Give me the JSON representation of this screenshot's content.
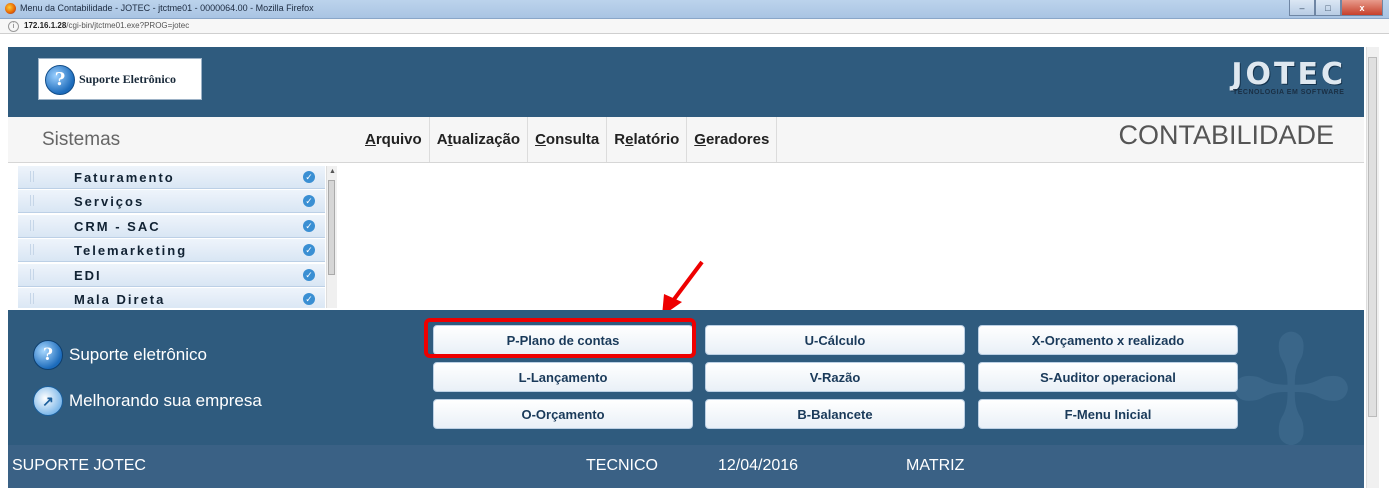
{
  "window": {
    "title": "Menu da Contabilidade - JOTEC - jtctme01 - 0000064.00 - Mozilla Firefox",
    "url_host": "172.16.1.28",
    "url_path": "/cgi-bin/jtctme01.exe?PROG=jotec",
    "min_glyph": "–",
    "max_glyph": "□",
    "close_glyph": "x"
  },
  "header": {
    "support_logo_text": "Suporte Eletrônico",
    "jotec_logo": "JOTEC",
    "jotec_tagline": "TECNOLOGIA EM SOFTWARE"
  },
  "menubar": {
    "sistemas": "Sistemas",
    "menus": [
      {
        "prefix": "",
        "underline": "A",
        "rest": "rquivo"
      },
      {
        "prefix": "A",
        "underline": "t",
        "rest": "ualização"
      },
      {
        "prefix": "",
        "underline": "C",
        "rest": "onsulta"
      },
      {
        "prefix": "R",
        "underline": "e",
        "rest": "latório"
      },
      {
        "prefix": "",
        "underline": "G",
        "rest": "eradores"
      }
    ],
    "module_title": "CONTABILIDADE"
  },
  "sidebar": {
    "items": [
      "Faturamento",
      "Serviços",
      "CRM - SAC",
      "Telemarketing",
      "EDI",
      "Mala Direta"
    ]
  },
  "promo": {
    "line1": "Suporte eletrônico",
    "line2": "Melhorando sua empresa"
  },
  "buttons": {
    "plano": "P-Plano de contas",
    "calculo": "U-Cálculo",
    "orcamento_realizado": "X-Orçamento x realizado",
    "lancamento": "L-Lançamento",
    "razao": "V-Razão",
    "auditor": "S-Auditor operacional",
    "orcamento": "O-Orçamento",
    "balancete": "B-Balancete",
    "menu_inicial": "F-Menu Inicial"
  },
  "footer": {
    "user": "SUPORTE JOTEC",
    "role": "TECNICO",
    "date": "12/04/2016",
    "branch": "MATRIZ"
  },
  "colors": {
    "header_bg": "#2f5b7e",
    "footer_bg": "#3a6185",
    "highlight": "#e00000"
  }
}
